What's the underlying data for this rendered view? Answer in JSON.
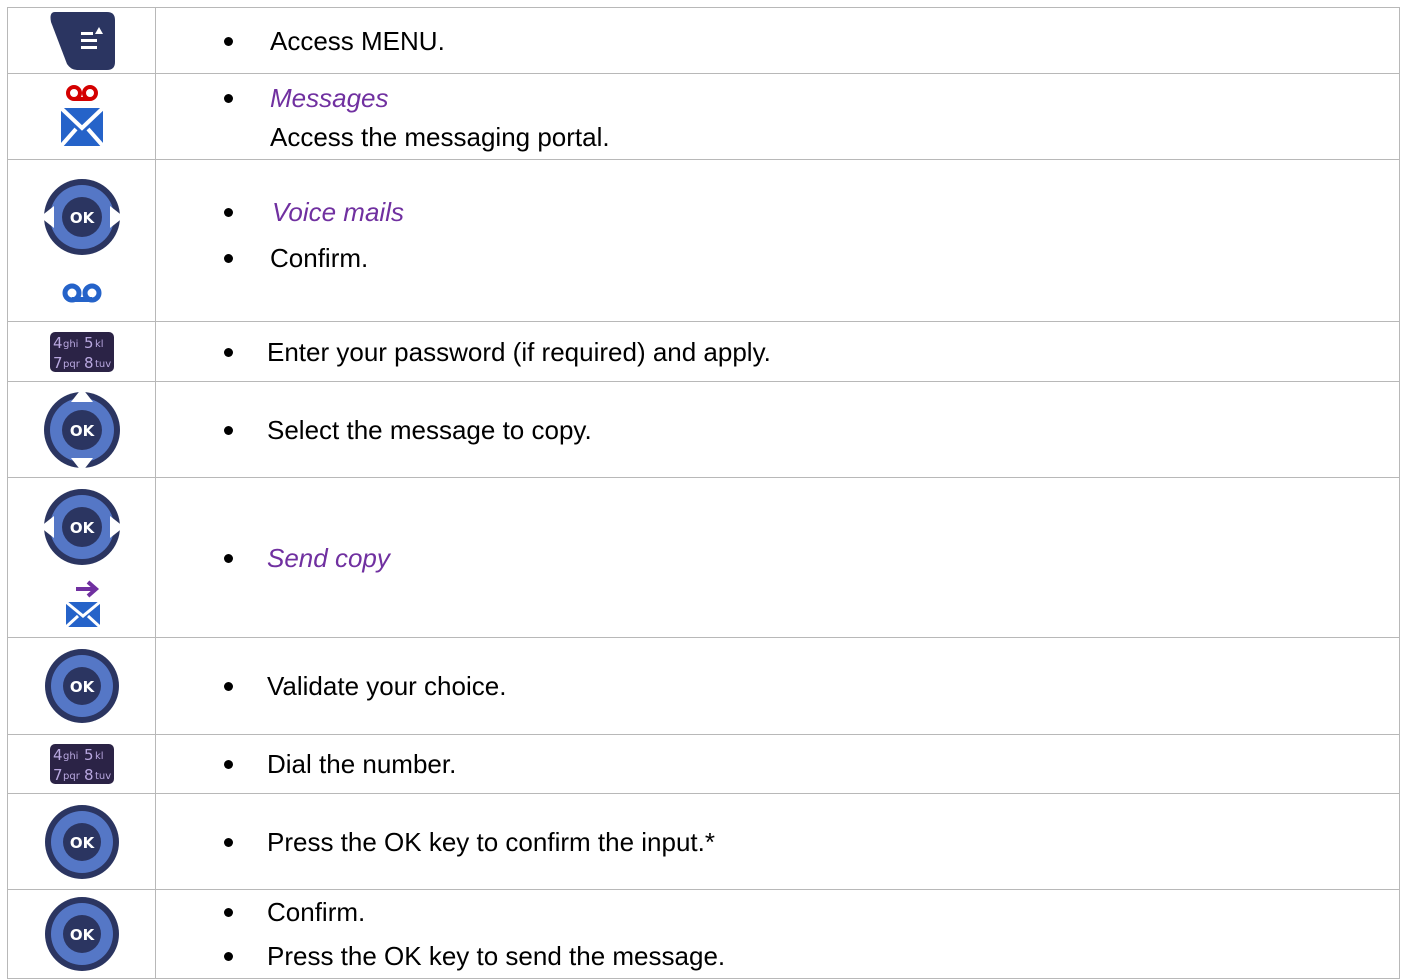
{
  "rows": [
    {
      "icon": "menu-key-icon",
      "lines": [
        {
          "text": "Access MENU.",
          "italic": false
        }
      ]
    },
    {
      "icon": "messages-icon",
      "lines": [
        {
          "text": "Messages",
          "italic": true
        }
      ],
      "sub": "Access the messaging portal."
    },
    {
      "icon": "navigator-left-right-icon",
      "icon2": "voicemail-icon",
      "lines": [
        {
          "text": "Voice mails",
          "italic": true
        },
        {
          "text": "Confirm.",
          "italic": false
        }
      ]
    },
    {
      "icon": "keypad-icon",
      "lines": [
        {
          "text": "Enter your password (if required) and apply.",
          "italic": false
        }
      ]
    },
    {
      "icon": "navigator-up-down-icon",
      "lines": [
        {
          "text": "Select the message to copy.",
          "italic": false
        }
      ]
    },
    {
      "icon": "navigator-left-right-icon",
      "icon2": "send-copy-icon",
      "lines": [
        {
          "text": "Send copy",
          "italic": true
        }
      ]
    },
    {
      "icon": "ok-key-icon",
      "lines": [
        {
          "text": "Validate your choice.",
          "italic": false
        }
      ]
    },
    {
      "icon": "keypad-icon",
      "lines": [
        {
          "text": "Dial the number.",
          "italic": false
        }
      ]
    },
    {
      "icon": "ok-key-icon",
      "lines": [
        {
          "text": "Press the OK key to confirm the input.*",
          "italic": false
        }
      ]
    },
    {
      "icon": "ok-key-icon",
      "lines": [
        {
          "text": "Confirm.",
          "italic": false
        },
        {
          "text": "Press the OK key to send the message.",
          "italic": false
        }
      ]
    }
  ],
  "labels": {
    "ok": "OK",
    "keypad": [
      "4",
      "ghi",
      "5",
      "kl",
      "7",
      "pqr",
      "8",
      "tuv"
    ]
  },
  "colors": {
    "navy": "#2b3561",
    "blue": "#3a5dbf",
    "ring": "#8aa0d8",
    "purple": "#7030a0",
    "red": "#d40000",
    "border": "#b8b8b8"
  }
}
